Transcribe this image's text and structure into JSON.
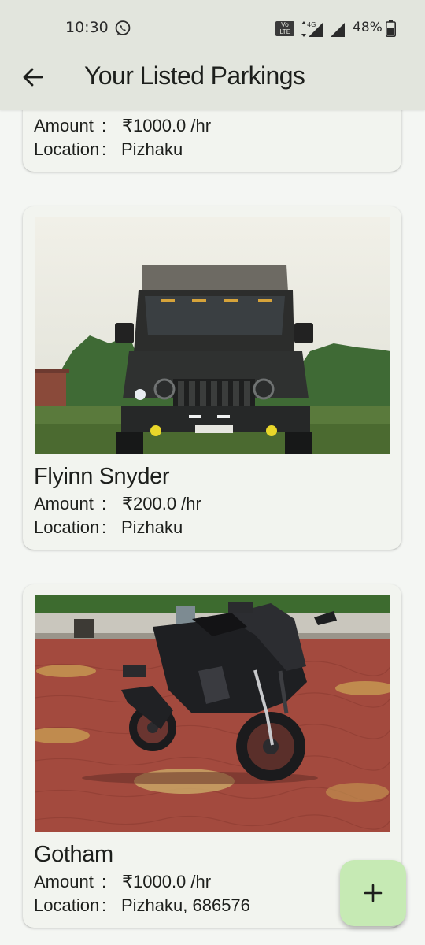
{
  "status_bar": {
    "time": "10:30",
    "volte_label": "Vo LTE",
    "network_label": "4G",
    "battery": "48%"
  },
  "app_bar": {
    "title": "Your Listed Parkings",
    "back_icon": "arrow-back-icon"
  },
  "parkings": [
    {
      "name": "",
      "amount_label": "Amount",
      "amount": "₹1000.0 /hr",
      "location_label": "Location",
      "location": "Pizhaku"
    },
    {
      "name": "Flyinn Snyder",
      "amount_label": "Amount",
      "amount": "₹200.0 /hr",
      "location_label": "Location",
      "location": "Pizhaku",
      "image": "black-suv-on-grass-photo"
    },
    {
      "name": "Gotham",
      "amount_label": "Amount",
      "amount": "₹1000.0 /hr",
      "location_label": "Location",
      "location": "Pizhaku, 686576",
      "image": "black-sport-motorcycle-photo"
    }
  ],
  "fab": {
    "icon": "plus-icon"
  },
  "colors": {
    "background": "#f4f6f3",
    "app_bar": "#e2e5dd",
    "card": "#f2f4ef",
    "fab": "#c6eab4"
  }
}
